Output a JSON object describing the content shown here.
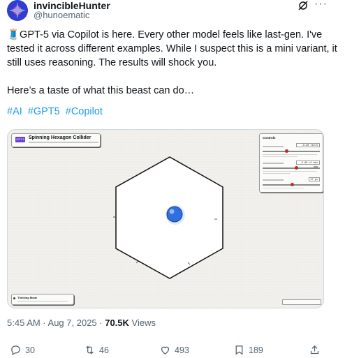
{
  "author": {
    "name": "invincibleHunter",
    "handle": "@hunoematic",
    "avatar_icon": "avatar-image"
  },
  "post": {
    "lines": [
      "🧵GPT-5 via Copilot is here. Every other model feels like last-gen. I've tested it across different examples. While I suspect this is a mini variant, it still uses reasoning. The results will shock you.",
      "Here’s a taste of what this beast can do…"
    ],
    "hashtags": [
      "#AI",
      "#GPT5",
      "#Copilot"
    ]
  },
  "media": {
    "badge": "GPT-5",
    "title": "Spinning Hexagon Collider",
    "controls": {
      "title": "Controls",
      "values": [
        "-0.30 rev/s",
        "0.60 of min dim",
        "47 px"
      ]
    },
    "thinking": "Thinking Mode"
  },
  "meta": {
    "time": "5:45 AM · Aug 7, 2025 ·",
    "views": "70.5K",
    "views_label": "Views"
  },
  "actions": {
    "replies": "30",
    "reposts": "46",
    "likes": "493",
    "bookmarks": "189"
  },
  "colors": {
    "accent": "#1d9bf0",
    "muted": "#536471",
    "ball": "#2f6fe0"
  }
}
